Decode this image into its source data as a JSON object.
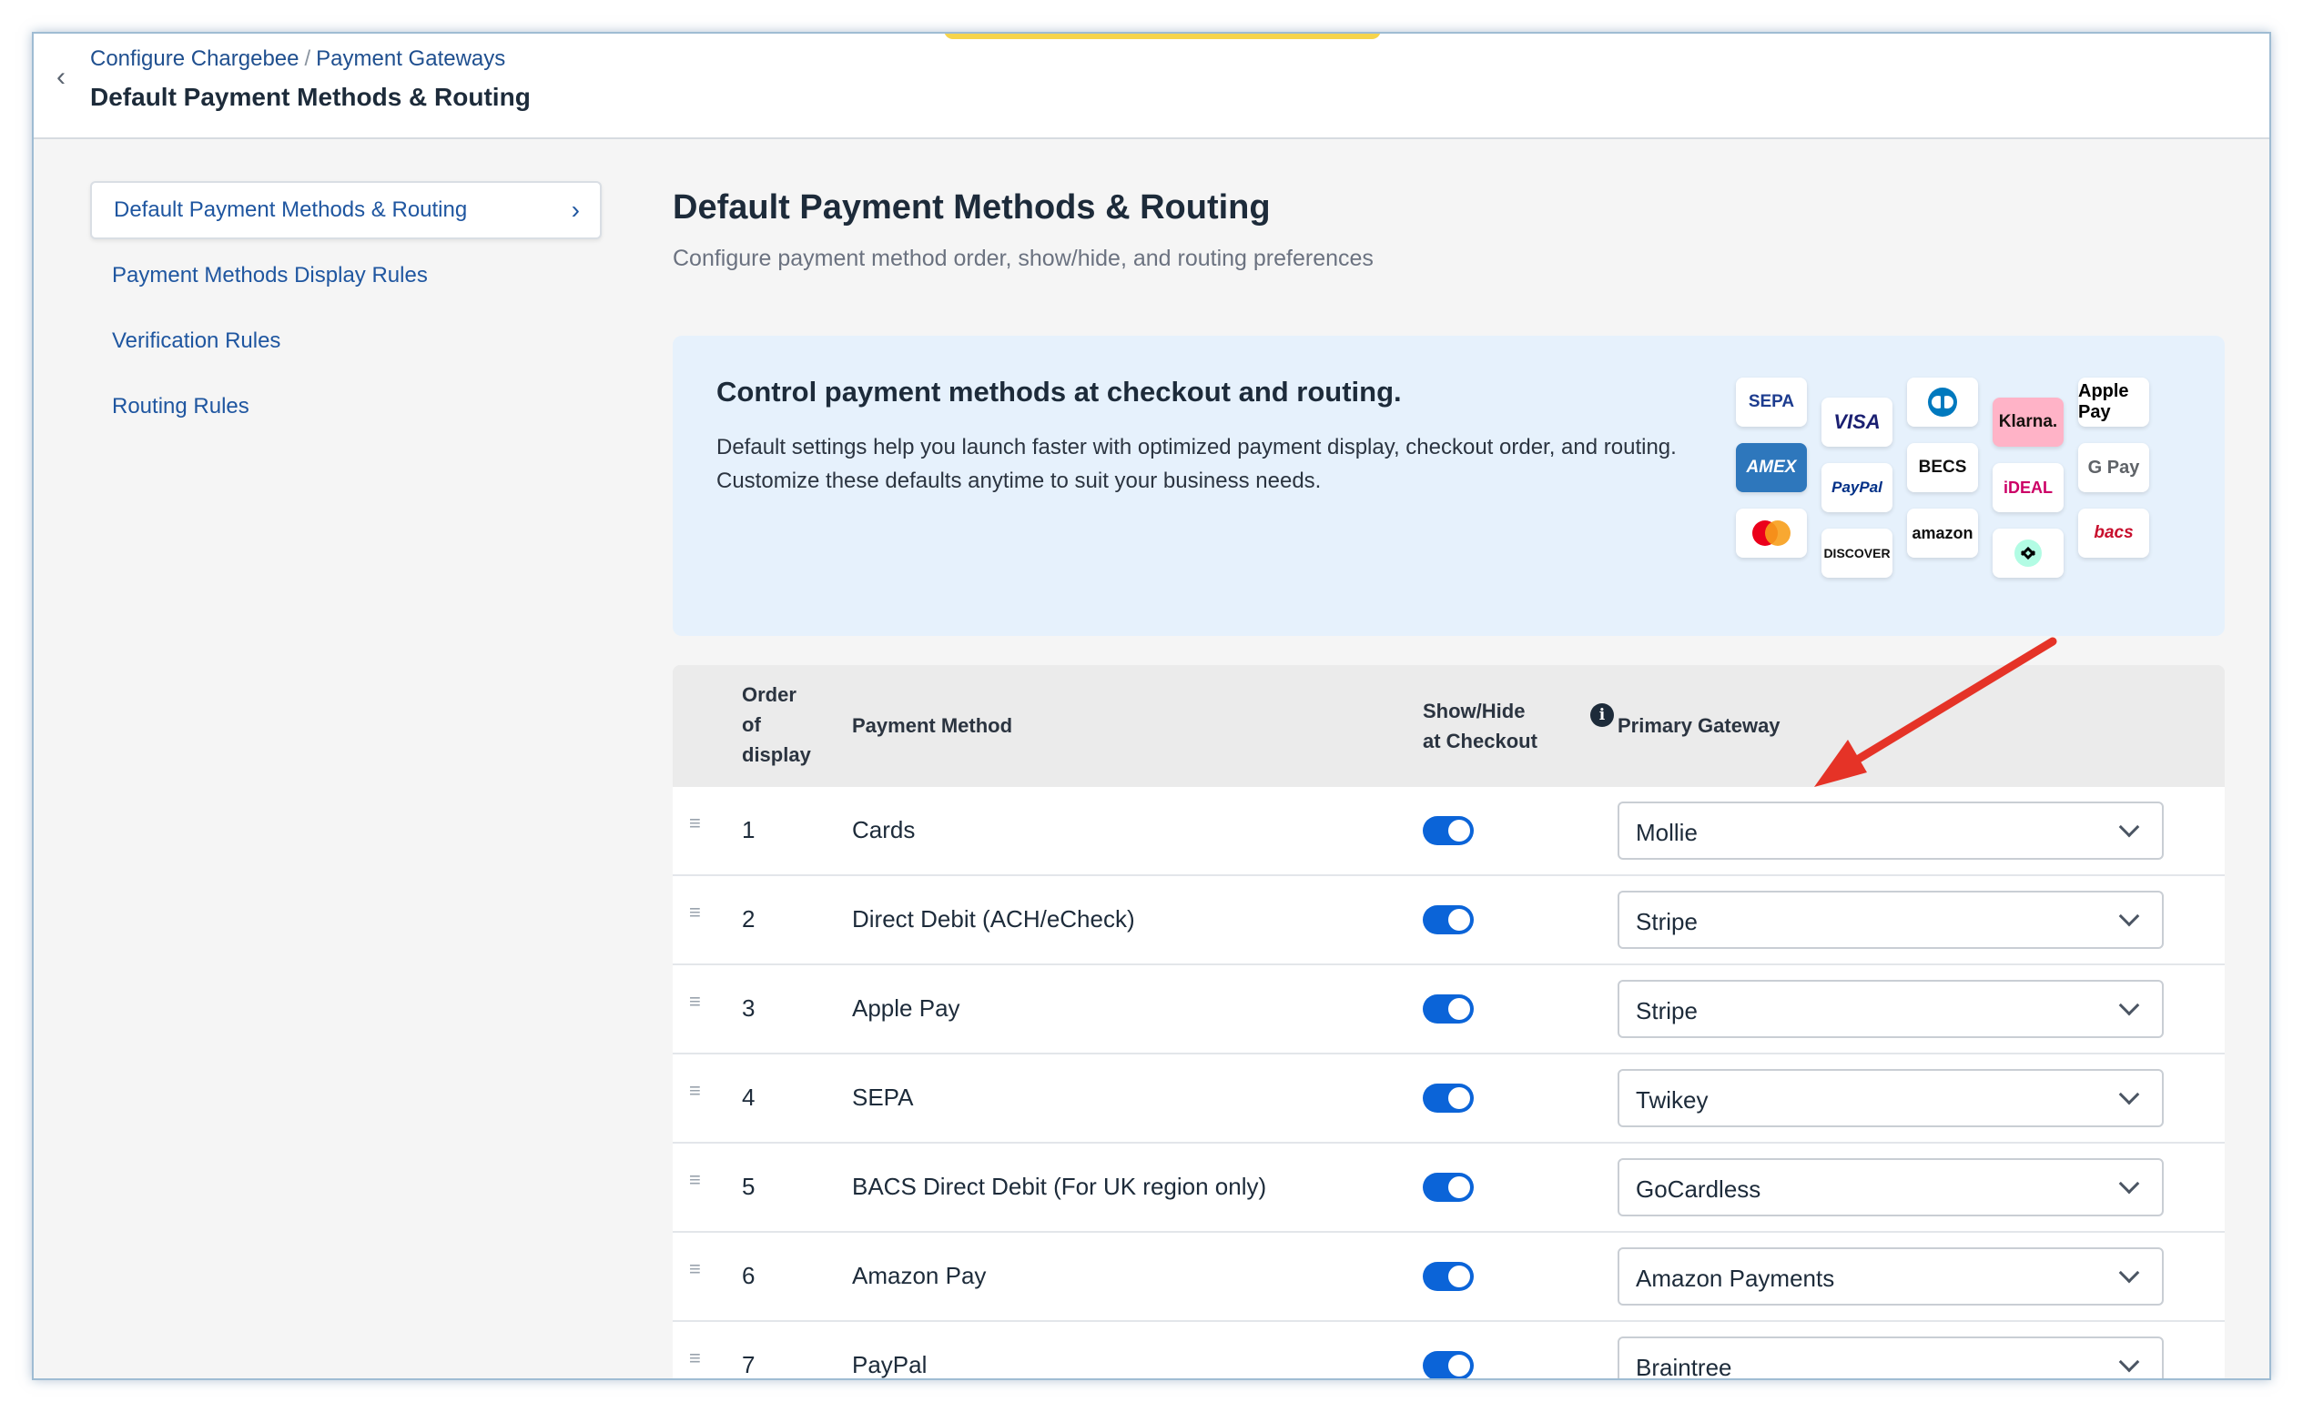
{
  "header": {
    "breadcrumb": [
      "Configure Chargebee",
      "Payment Gateways"
    ],
    "breadcrumb_sep": "/",
    "title": "Default Payment Methods & Routing",
    "back_icon": "chevron-left-icon"
  },
  "sidebar": {
    "items": [
      {
        "label": "Default Payment Methods & Routing",
        "active": true
      },
      {
        "label": "Payment Methods Display Rules",
        "active": false
      },
      {
        "label": "Verification Rules",
        "active": false
      },
      {
        "label": "Routing Rules",
        "active": false
      }
    ],
    "active_chevron": "›"
  },
  "main": {
    "title": "Default Payment Methods & Routing",
    "subtitle": "Configure payment method order, show/hide, and routing preferences"
  },
  "banner": {
    "title": "Control payment methods at checkout and routing.",
    "text": "Default settings help you launch faster with optimized payment display, checkout order, and routing. Customize these defaults anytime to suit your business needs.",
    "logos": [
      "SEPA",
      "VISA",
      "Diners",
      "Klarna.",
      "Apple Pay",
      "AMEX",
      "PayPal",
      "BECS",
      "iDEAL",
      "G Pay",
      "Mastercard",
      "DISCOVER",
      "amazon",
      "Afterpay",
      "bacs"
    ]
  },
  "table": {
    "headers": {
      "order": [
        "Order",
        "of",
        "display"
      ],
      "method": "Payment Method",
      "showhide": [
        "Show/Hide",
        "at Checkout"
      ],
      "gateway": "Primary Gateway"
    },
    "rows": [
      {
        "order": "1",
        "method": "Cards",
        "visible": true,
        "gateway": "Mollie"
      },
      {
        "order": "2",
        "method": "Direct Debit (ACH/eCheck)",
        "visible": true,
        "gateway": "Stripe"
      },
      {
        "order": "3",
        "method": "Apple Pay",
        "visible": true,
        "gateway": "Stripe"
      },
      {
        "order": "4",
        "method": "SEPA",
        "visible": true,
        "gateway": "Twikey"
      },
      {
        "order": "5",
        "method": "BACS Direct Debit (For UK region only)",
        "visible": true,
        "gateway": "GoCardless"
      },
      {
        "order": "6",
        "method": "Amazon Pay",
        "visible": true,
        "gateway": "Amazon Payments"
      },
      {
        "order": "7",
        "method": "PayPal",
        "visible": true,
        "gateway": "Braintree"
      }
    ]
  },
  "colors": {
    "accent": "#0b64d8",
    "link": "#1f56a0",
    "banner_bg": "#e6f1fc",
    "annotation_arrow": "#e53327"
  }
}
